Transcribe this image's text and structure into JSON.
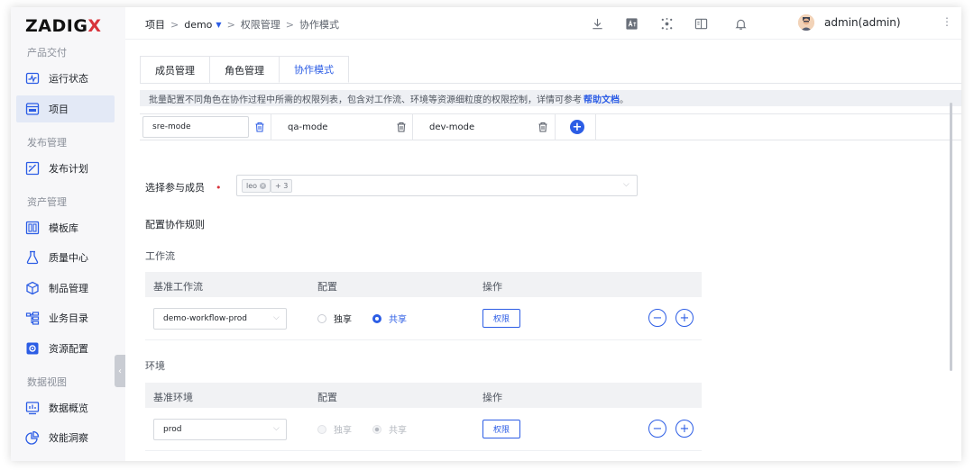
{
  "brand": {
    "logo_text": "ZADIG",
    "logo_accent": "X"
  },
  "sidebar": {
    "groups": [
      {
        "title": "产品交付"
      },
      {
        "title": "发布管理"
      },
      {
        "title": "资产管理"
      },
      {
        "title": "数据视图"
      }
    ],
    "items": [
      {
        "label": "运行状态",
        "icon": "pulse-icon"
      },
      {
        "label": "项目",
        "icon": "project-icon",
        "active": true
      },
      {
        "label": "发布计划",
        "icon": "release-plan-icon"
      },
      {
        "label": "模板库",
        "icon": "template-icon"
      },
      {
        "label": "质量中心",
        "icon": "flask-icon"
      },
      {
        "label": "制品管理",
        "icon": "package-icon"
      },
      {
        "label": "业务目录",
        "icon": "catalog-icon"
      },
      {
        "label": "资源配置",
        "icon": "gear-icon"
      },
      {
        "label": "数据概览",
        "icon": "dashboard-icon"
      },
      {
        "label": "效能洞察",
        "icon": "pie-chart-icon"
      }
    ],
    "collapse_glyph": "‹"
  },
  "topbar": {
    "breadcrumb": [
      "项目",
      "demo",
      "权限管理",
      "协作模式"
    ],
    "separator": ">",
    "user": "admin(admin)",
    "more_glyph": "⋮"
  },
  "tabs": [
    {
      "label": "成员管理"
    },
    {
      "label": "角色管理"
    },
    {
      "label": "协作模式",
      "active": true
    }
  ],
  "notice": {
    "text": "批量配置不同角色在协作过程中所需的权限列表，包含对工作流、环境等资源细粒度的权限控制，详情可参考",
    "link": "帮助文档",
    "suffix": "。"
  },
  "modes": [
    {
      "name": "sre-mode",
      "editing": true
    },
    {
      "name": "qa-mode"
    },
    {
      "name": "dev-mode"
    }
  ],
  "members": {
    "label": "选择参与成员",
    "required_mark": "•",
    "chips": [
      "leo",
      "+ 3"
    ]
  },
  "rules_title": "配置协作规则",
  "workflow": {
    "section_title": "工作流",
    "headers": [
      "基准工作流",
      "配置",
      "操作"
    ],
    "row": {
      "select": "demo-workflow-prod",
      "options": [
        "独享",
        "共享"
      ],
      "selected": "共享",
      "perm_button": "权限"
    }
  },
  "environment": {
    "section_title": "环境",
    "headers": [
      "基准环境",
      "配置",
      "操作"
    ],
    "row": {
      "select": "prod",
      "options": [
        "独享",
        "共享"
      ],
      "selected": "共享",
      "disabled": true,
      "perm_button": "权限"
    }
  },
  "colors": {
    "accent": "#2c5de5",
    "danger": "#d8333b",
    "sidebar_bg": "#f7f7f9"
  }
}
